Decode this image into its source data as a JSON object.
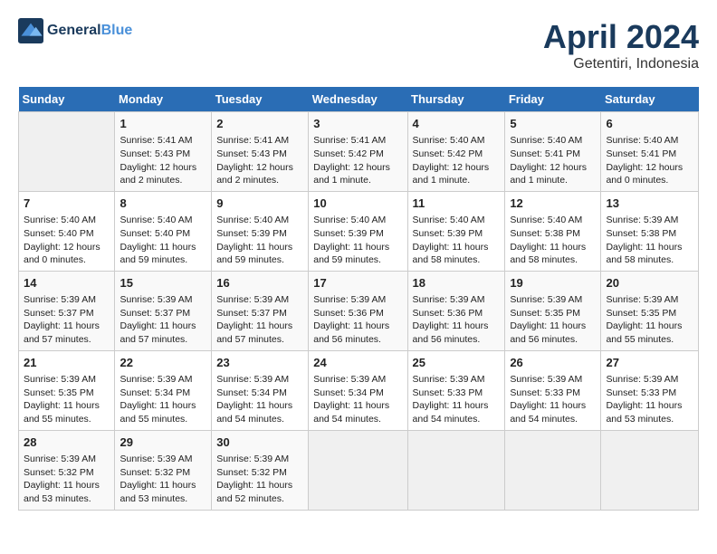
{
  "header": {
    "logo_general": "General",
    "logo_blue": "Blue",
    "month": "April 2024",
    "location": "Getentiri, Indonesia"
  },
  "days_of_week": [
    "Sunday",
    "Monday",
    "Tuesday",
    "Wednesday",
    "Thursday",
    "Friday",
    "Saturday"
  ],
  "weeks": [
    [
      {
        "day": "",
        "empty": true
      },
      {
        "day": "1",
        "sunrise": "Sunrise: 5:41 AM",
        "sunset": "Sunset: 5:43 PM",
        "daylight": "Daylight: 12 hours and 2 minutes."
      },
      {
        "day": "2",
        "sunrise": "Sunrise: 5:41 AM",
        "sunset": "Sunset: 5:43 PM",
        "daylight": "Daylight: 12 hours and 2 minutes."
      },
      {
        "day": "3",
        "sunrise": "Sunrise: 5:41 AM",
        "sunset": "Sunset: 5:42 PM",
        "daylight": "Daylight: 12 hours and 1 minute."
      },
      {
        "day": "4",
        "sunrise": "Sunrise: 5:40 AM",
        "sunset": "Sunset: 5:42 PM",
        "daylight": "Daylight: 12 hours and 1 minute."
      },
      {
        "day": "5",
        "sunrise": "Sunrise: 5:40 AM",
        "sunset": "Sunset: 5:41 PM",
        "daylight": "Daylight: 12 hours and 1 minute."
      },
      {
        "day": "6",
        "sunrise": "Sunrise: 5:40 AM",
        "sunset": "Sunset: 5:41 PM",
        "daylight": "Daylight: 12 hours and 0 minutes."
      }
    ],
    [
      {
        "day": "7",
        "sunrise": "Sunrise: 5:40 AM",
        "sunset": "Sunset: 5:40 PM",
        "daylight": "Daylight: 12 hours and 0 minutes."
      },
      {
        "day": "8",
        "sunrise": "Sunrise: 5:40 AM",
        "sunset": "Sunset: 5:40 PM",
        "daylight": "Daylight: 11 hours and 59 minutes."
      },
      {
        "day": "9",
        "sunrise": "Sunrise: 5:40 AM",
        "sunset": "Sunset: 5:39 PM",
        "daylight": "Daylight: 11 hours and 59 minutes."
      },
      {
        "day": "10",
        "sunrise": "Sunrise: 5:40 AM",
        "sunset": "Sunset: 5:39 PM",
        "daylight": "Daylight: 11 hours and 59 minutes."
      },
      {
        "day": "11",
        "sunrise": "Sunrise: 5:40 AM",
        "sunset": "Sunset: 5:39 PM",
        "daylight": "Daylight: 11 hours and 58 minutes."
      },
      {
        "day": "12",
        "sunrise": "Sunrise: 5:40 AM",
        "sunset": "Sunset: 5:38 PM",
        "daylight": "Daylight: 11 hours and 58 minutes."
      },
      {
        "day": "13",
        "sunrise": "Sunrise: 5:39 AM",
        "sunset": "Sunset: 5:38 PM",
        "daylight": "Daylight: 11 hours and 58 minutes."
      }
    ],
    [
      {
        "day": "14",
        "sunrise": "Sunrise: 5:39 AM",
        "sunset": "Sunset: 5:37 PM",
        "daylight": "Daylight: 11 hours and 57 minutes."
      },
      {
        "day": "15",
        "sunrise": "Sunrise: 5:39 AM",
        "sunset": "Sunset: 5:37 PM",
        "daylight": "Daylight: 11 hours and 57 minutes."
      },
      {
        "day": "16",
        "sunrise": "Sunrise: 5:39 AM",
        "sunset": "Sunset: 5:37 PM",
        "daylight": "Daylight: 11 hours and 57 minutes."
      },
      {
        "day": "17",
        "sunrise": "Sunrise: 5:39 AM",
        "sunset": "Sunset: 5:36 PM",
        "daylight": "Daylight: 11 hours and 56 minutes."
      },
      {
        "day": "18",
        "sunrise": "Sunrise: 5:39 AM",
        "sunset": "Sunset: 5:36 PM",
        "daylight": "Daylight: 11 hours and 56 minutes."
      },
      {
        "day": "19",
        "sunrise": "Sunrise: 5:39 AM",
        "sunset": "Sunset: 5:35 PM",
        "daylight": "Daylight: 11 hours and 56 minutes."
      },
      {
        "day": "20",
        "sunrise": "Sunrise: 5:39 AM",
        "sunset": "Sunset: 5:35 PM",
        "daylight": "Daylight: 11 hours and 55 minutes."
      }
    ],
    [
      {
        "day": "21",
        "sunrise": "Sunrise: 5:39 AM",
        "sunset": "Sunset: 5:35 PM",
        "daylight": "Daylight: 11 hours and 55 minutes."
      },
      {
        "day": "22",
        "sunrise": "Sunrise: 5:39 AM",
        "sunset": "Sunset: 5:34 PM",
        "daylight": "Daylight: 11 hours and 55 minutes."
      },
      {
        "day": "23",
        "sunrise": "Sunrise: 5:39 AM",
        "sunset": "Sunset: 5:34 PM",
        "daylight": "Daylight: 11 hours and 54 minutes."
      },
      {
        "day": "24",
        "sunrise": "Sunrise: 5:39 AM",
        "sunset": "Sunset: 5:34 PM",
        "daylight": "Daylight: 11 hours and 54 minutes."
      },
      {
        "day": "25",
        "sunrise": "Sunrise: 5:39 AM",
        "sunset": "Sunset: 5:33 PM",
        "daylight": "Daylight: 11 hours and 54 minutes."
      },
      {
        "day": "26",
        "sunrise": "Sunrise: 5:39 AM",
        "sunset": "Sunset: 5:33 PM",
        "daylight": "Daylight: 11 hours and 54 minutes."
      },
      {
        "day": "27",
        "sunrise": "Sunrise: 5:39 AM",
        "sunset": "Sunset: 5:33 PM",
        "daylight": "Daylight: 11 hours and 53 minutes."
      }
    ],
    [
      {
        "day": "28",
        "sunrise": "Sunrise: 5:39 AM",
        "sunset": "Sunset: 5:32 PM",
        "daylight": "Daylight: 11 hours and 53 minutes."
      },
      {
        "day": "29",
        "sunrise": "Sunrise: 5:39 AM",
        "sunset": "Sunset: 5:32 PM",
        "daylight": "Daylight: 11 hours and 53 minutes."
      },
      {
        "day": "30",
        "sunrise": "Sunrise: 5:39 AM",
        "sunset": "Sunset: 5:32 PM",
        "daylight": "Daylight: 11 hours and 52 minutes."
      },
      {
        "day": "",
        "empty": true
      },
      {
        "day": "",
        "empty": true
      },
      {
        "day": "",
        "empty": true
      },
      {
        "day": "",
        "empty": true
      }
    ]
  ]
}
